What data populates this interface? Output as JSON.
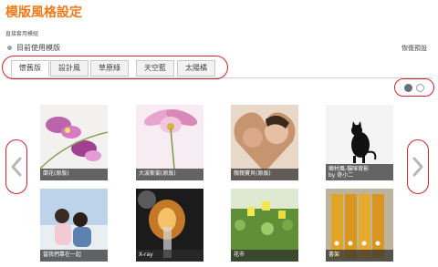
{
  "page": {
    "title": "模版風格設定",
    "subtitle": "直接套用模組",
    "current_label": "目前使用模版",
    "restore_default": "恢復預設"
  },
  "tabs": [
    {
      "label": "懷舊版",
      "active": true
    },
    {
      "label": "設計風",
      "active": false
    },
    {
      "label": "草原綠",
      "active": false
    },
    {
      "label": "天空藍",
      "active": false
    },
    {
      "label": "太陽橘",
      "active": false
    }
  ],
  "pagination": {
    "pages": 2,
    "current": 1
  },
  "thumbnails": [
    {
      "caption": "蘭花(原版)"
    },
    {
      "caption": "大波斯菊(原版)"
    },
    {
      "caption": "親親寶貝(原版)"
    },
    {
      "caption": "鄉村風-貓咪背影",
      "caption_line2": "by 奇小二"
    },
    {
      "caption": "當我們靠在一起"
    },
    {
      "caption": "X-ray"
    },
    {
      "caption": "花市"
    },
    {
      "caption": "書架"
    }
  ],
  "colors": {
    "title": "#f07a18",
    "highlight_outline": "#d8232a",
    "caption_bar": "#2d2d2d"
  },
  "icons": [
    "chevron-left-icon",
    "chevron-right-icon"
  ]
}
